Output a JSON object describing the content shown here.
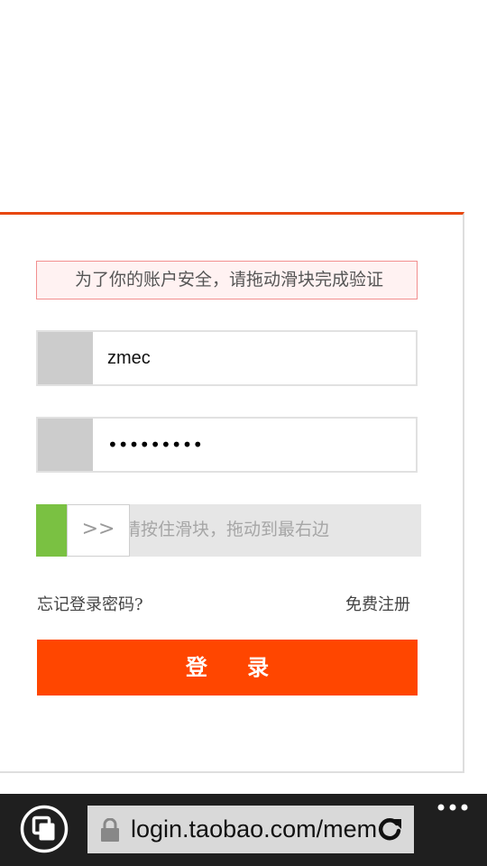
{
  "security_notice": "为了你的账户安全，请拖动滑块完成验证",
  "username": {
    "icon": "user-icon",
    "value": "zmec"
  },
  "password": {
    "icon": "lock-icon",
    "value": "•••••••••"
  },
  "slider": {
    "handle_label": ">>",
    "instruction": "请按住滑块，拖动到最右边",
    "progress_fraction": 0.08
  },
  "links": {
    "forgot_password": "忘记登录密码?",
    "register": "免费注册"
  },
  "login_button": "登  录",
  "browser": {
    "address": "login.taobao.com/member/login.jhtml",
    "tabs_icon": "tabs-icon",
    "secure_icon": "lock-icon",
    "refresh_icon": "refresh-icon",
    "more_icon": "more-dots-icon"
  },
  "colors": {
    "accent_orange": "#ff4600",
    "card_top_border": "#e8470f",
    "slider_green": "#7ac142",
    "notice_border": "#f28f8f",
    "browser_bar": "#1f1f1f"
  }
}
